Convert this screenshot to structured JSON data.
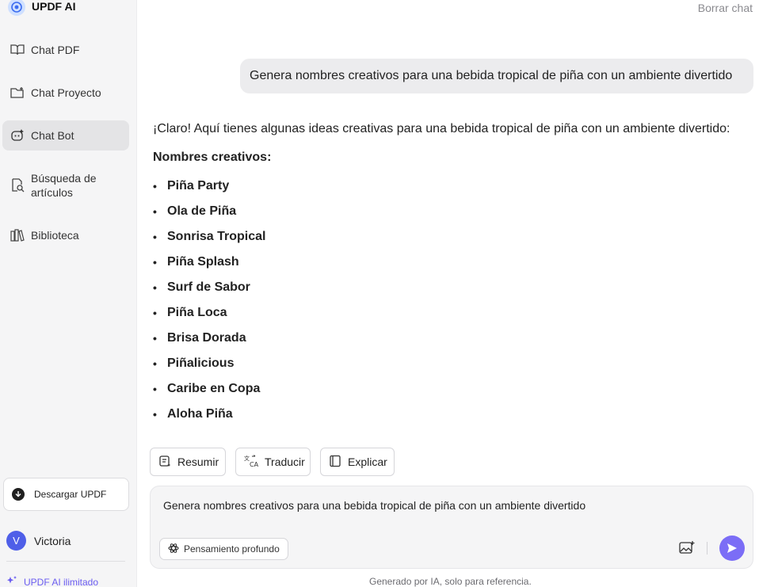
{
  "app": {
    "title": "UPDF AI"
  },
  "sidebar": {
    "items": [
      {
        "label": "Chat PDF",
        "icon": "book-open-icon"
      },
      {
        "label": "Chat Proyecto",
        "icon": "folder-add-icon"
      },
      {
        "label": "Chat Bot",
        "icon": "bot-icon",
        "active": true
      },
      {
        "label": "Búsqueda de artículos",
        "icon": "doc-search-icon"
      },
      {
        "label": "Biblioteca",
        "icon": "library-icon"
      }
    ],
    "download_label": "Descargar UPDF",
    "user": {
      "initial": "V",
      "name": "Victoria"
    },
    "upgrade_label": "UPDF AI ilimitado"
  },
  "header": {
    "clear_chat": "Borrar chat"
  },
  "conversation": {
    "user_message": "Genera nombres creativos para una bebida tropical de piña con un ambiente divertido",
    "reply_intro": "¡Claro! Aquí tienes algunas ideas creativas para una bebida tropical de piña con un ambiente divertido:",
    "reply_heading": "Nombres creativos:",
    "names": [
      "Piña Party",
      "Ola de Piña",
      "Sonrisa Tropical",
      "Piña Splash",
      "Surf de Sabor",
      "Piña Loca",
      "Brisa Dorada",
      "Piñalicious",
      "Caribe en Copa",
      "Aloha Piña"
    ]
  },
  "actions": {
    "summarize": "Resumir",
    "translate": "Traducir",
    "explain": "Explicar"
  },
  "composer": {
    "value": "Genera nombres creativos para una bebida tropical de piña con un ambiente divertido",
    "deep_think_label": "Pensamiento profundo"
  },
  "footer": {
    "note": "Generado por IA, solo para referencia."
  },
  "colors": {
    "accent": "#7b6df6",
    "upgrade": "#6a5cf0",
    "avatar": "#4f5fe8"
  }
}
